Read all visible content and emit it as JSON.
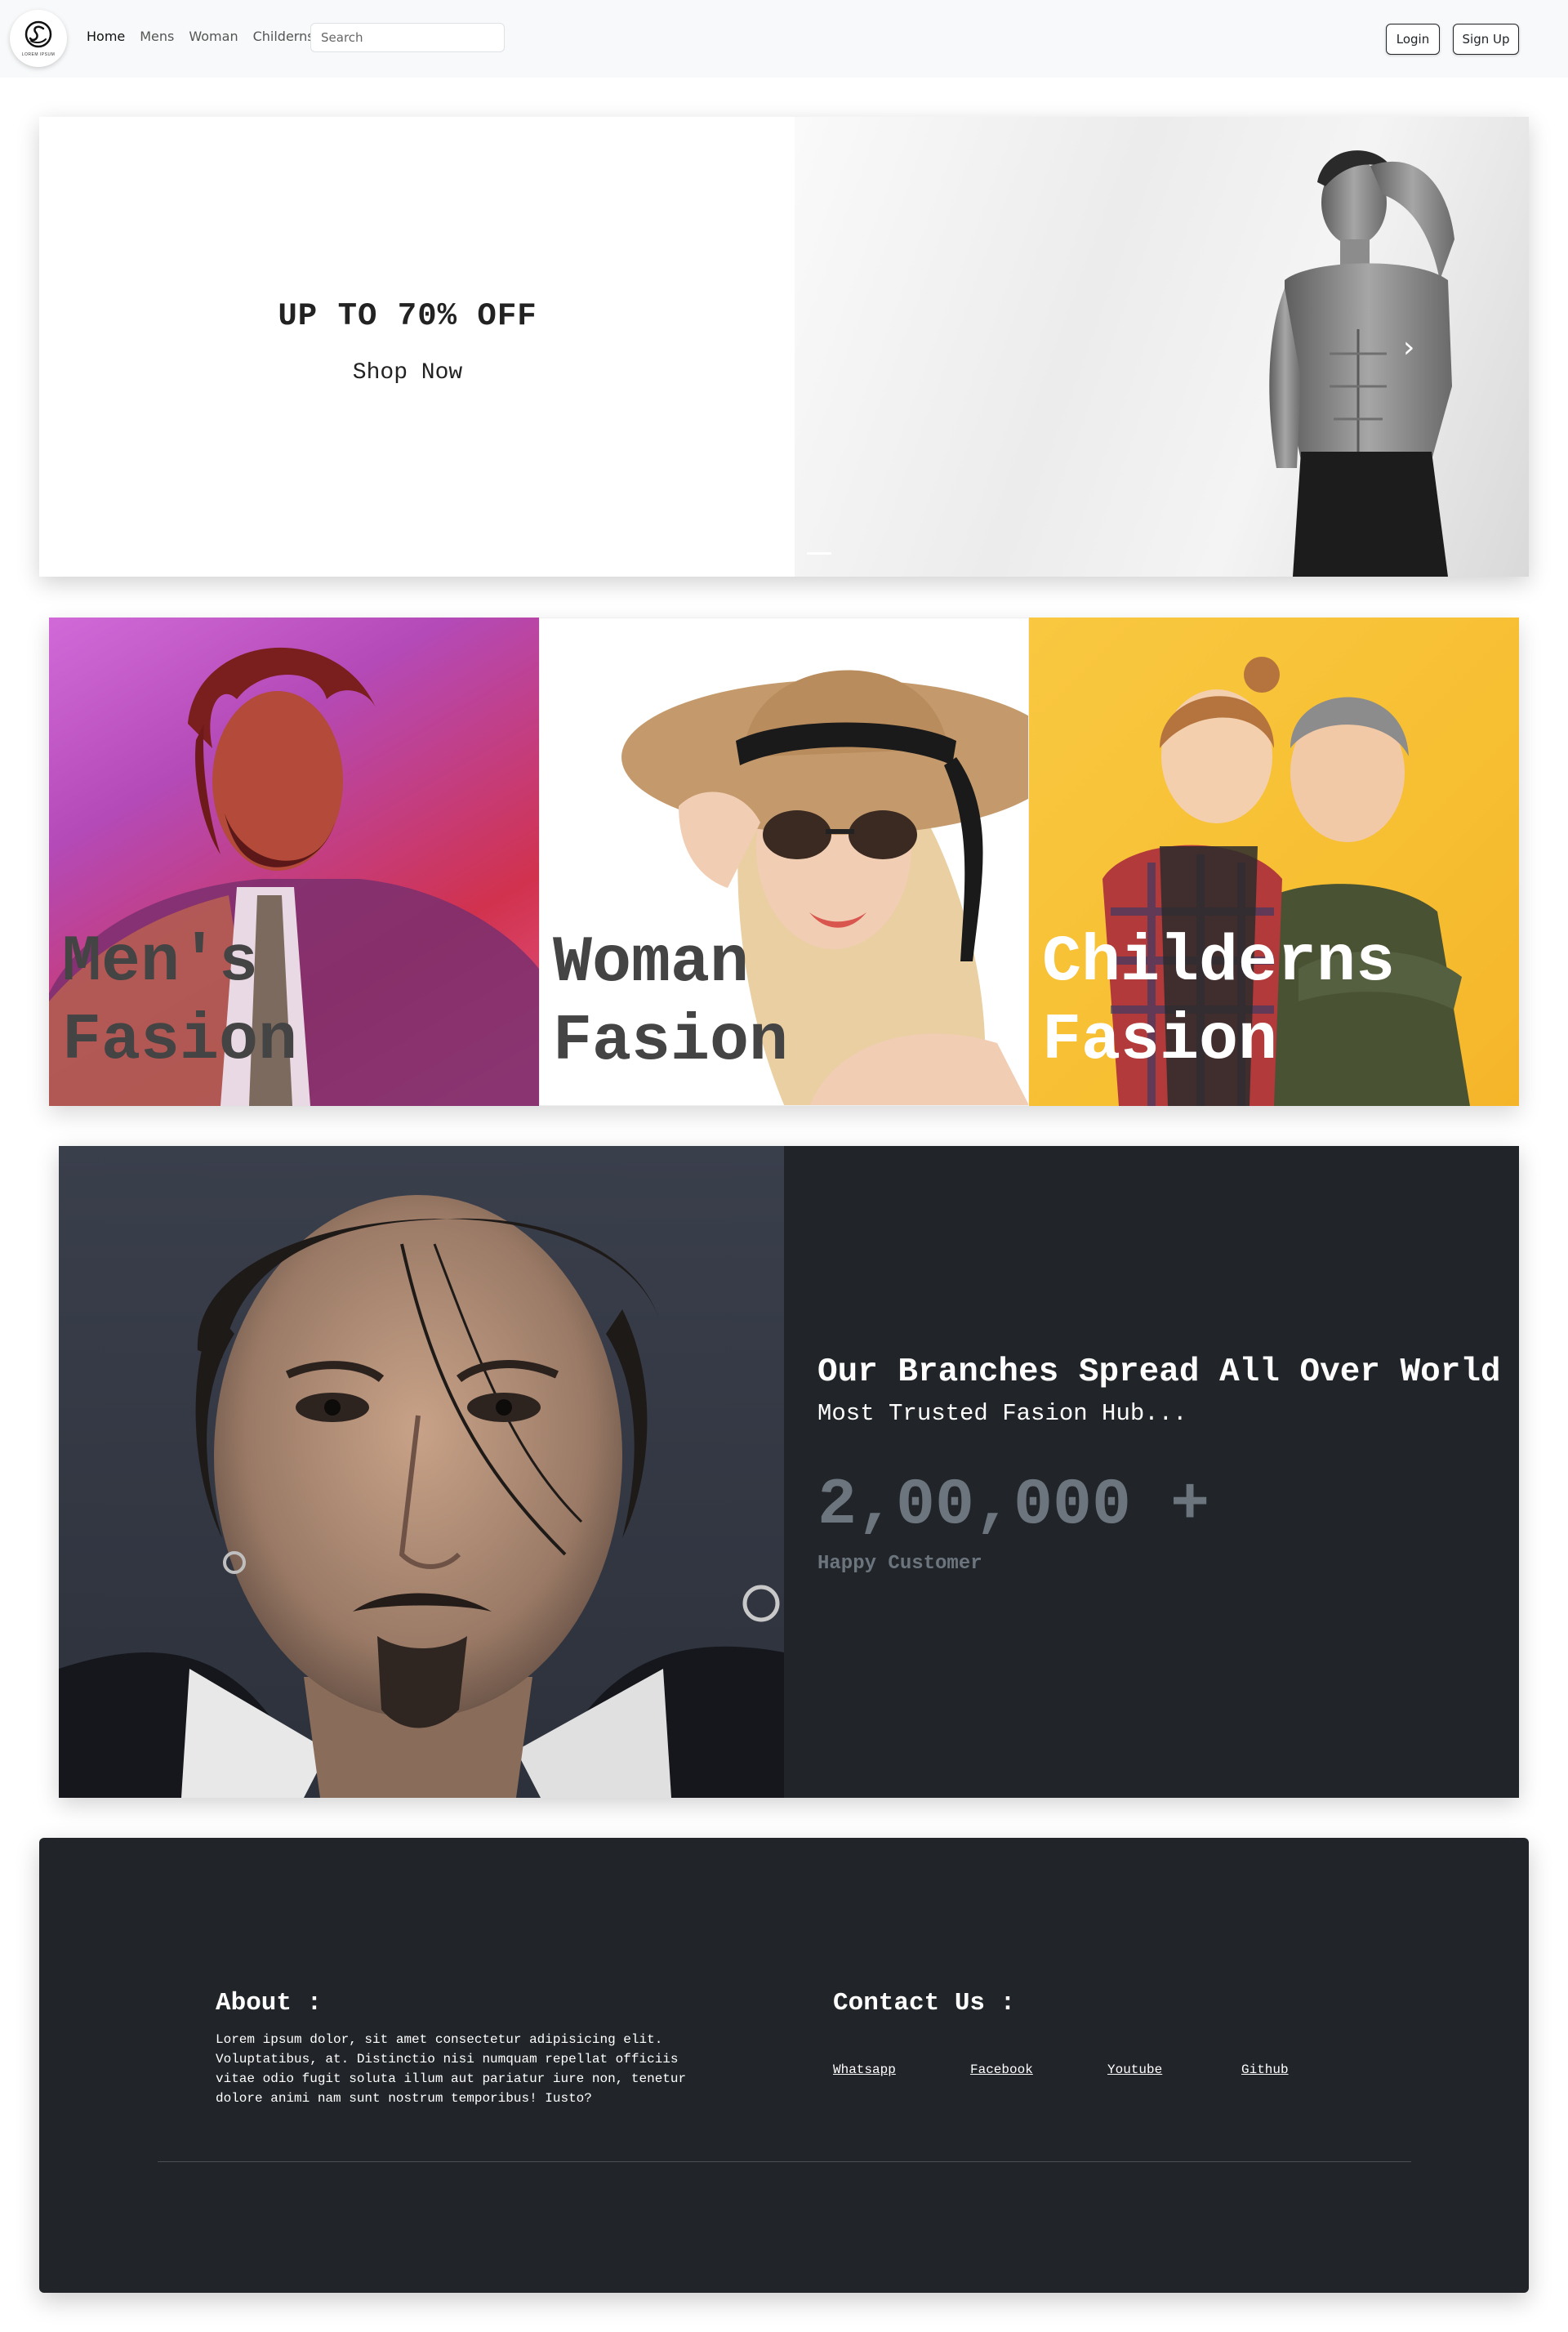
{
  "navbar": {
    "logo_text": "LOREM IPSUM",
    "links": [
      {
        "label": "Home",
        "active": true
      },
      {
        "label": "Mens",
        "active": false
      },
      {
        "label": "Woman",
        "active": false
      },
      {
        "label": "Childerns",
        "active": false
      }
    ],
    "search": {
      "placeholder": "Search",
      "value": ""
    },
    "login_label": "Login",
    "signup_label": "Sign Up"
  },
  "hero": {
    "title": "UP TO 70% OFF",
    "subtitle": "Shop Now",
    "next_glyph": "›"
  },
  "categories": [
    {
      "line1": "Men's",
      "line2": "Fasion"
    },
    {
      "line1": "Woman",
      "line2": "Fasion"
    },
    {
      "line1": "Childerns",
      "line2": "Fasion"
    }
  ],
  "branches": {
    "title": "Our Branches Spread All Over World",
    "subtitle": "Most Trusted Fasion Hub...",
    "number": "2,00,000 +",
    "caption": "Happy Customer"
  },
  "footer": {
    "about_title": "About :",
    "about_text": "Lorem ipsum dolor, sit amet consectetur adipisicing elit. Voluptatibus, at. Distinctio nisi numquam repellat officiis vitae odio fugit soluta illum aut pariatur iure non, tenetur dolore animi nam sunt nostrum temporibus! Iusto?",
    "contact_title": "Contact Us :",
    "links": [
      "Whatsapp",
      "Facebook",
      "Youtube",
      "Github"
    ]
  },
  "colors": {
    "dark": "#212529",
    "muted": "#6c757d",
    "navbar_bg": "#f8f9fa"
  }
}
